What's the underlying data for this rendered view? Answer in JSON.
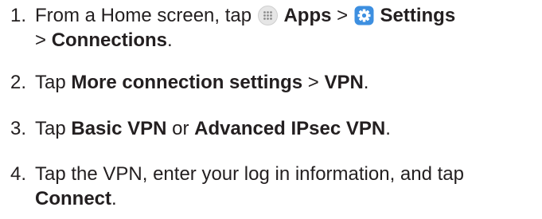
{
  "steps": [
    {
      "number": "1.",
      "text_a": "From a Home screen, tap",
      "apps_label": "Apps",
      "sep1": ">",
      "settings_label": "Settings",
      "sep2": ">",
      "connections_label": "Connections",
      "end": "."
    },
    {
      "number": "2.",
      "text_a": "Tap",
      "more_label": "More connection settings",
      "sep": ">",
      "vpn_label": "VPN",
      "end": "."
    },
    {
      "number": "3.",
      "text_a": "Tap",
      "basic_label": "Basic VPN",
      "or": "or",
      "advanced_label": "Advanced IPsec VPN",
      "end": "."
    },
    {
      "number": "4.",
      "text_a": "Tap the VPN, enter your log in information, and tap",
      "connect_label": "Connect",
      "end": "."
    }
  ],
  "icons": {
    "apps": "apps-grid-icon",
    "settings": "settings-gear-icon",
    "apps_color": "#d9d9d9",
    "settings_color": "#3d8fe0"
  }
}
